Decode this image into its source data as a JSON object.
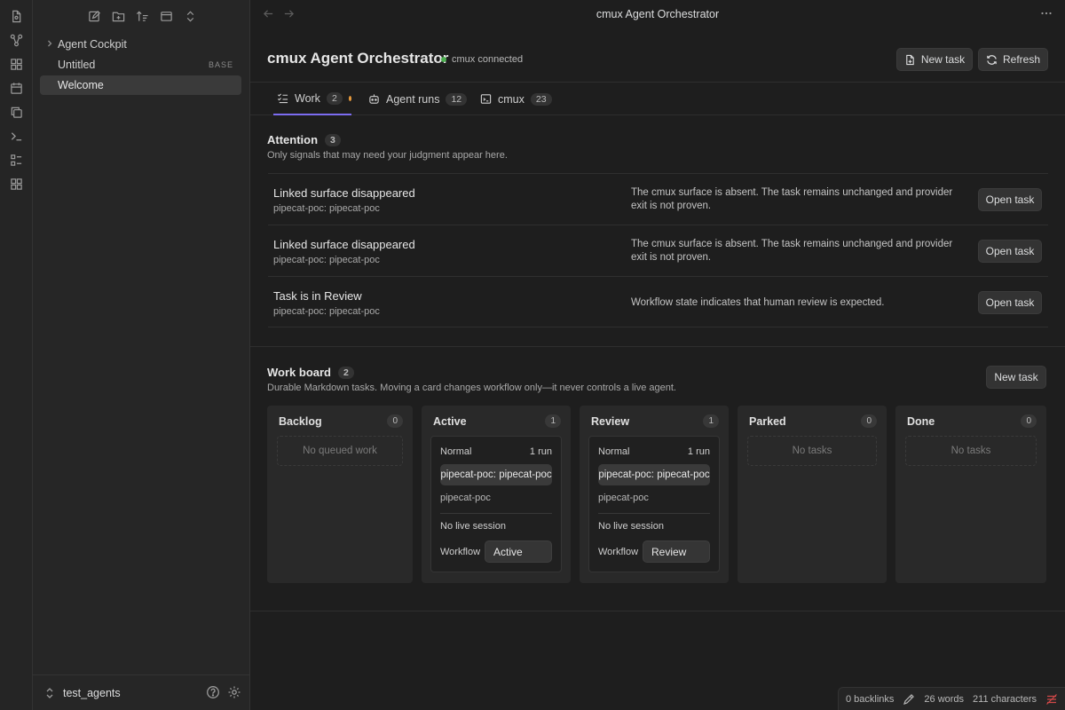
{
  "ribbon": {
    "icons": [
      "file-icon",
      "graph-icon",
      "grid-icon",
      "calendar-icon",
      "copy-icon",
      "terminal-icon",
      "list-icon",
      "blocks-icon"
    ]
  },
  "sidebar": {
    "toolbar_icons": [
      "new-note-icon",
      "new-folder-icon",
      "sort-icon",
      "collapse-icon",
      "expand-icon"
    ],
    "items": [
      {
        "label": "Agent Cockpit",
        "collapsed": true
      },
      {
        "label": "Untitled",
        "badge": "BASE"
      },
      {
        "label": "Welcome",
        "active": true
      }
    ],
    "vault": {
      "name": "test_agents"
    }
  },
  "titlebar": {
    "title": "cmux Agent Orchestrator"
  },
  "header": {
    "title": "cmux Agent Orchestrator",
    "connection": "cmux connected",
    "connection_color": "#4caf50",
    "new_task_label": "New task",
    "refresh_label": "Refresh"
  },
  "tabs": [
    {
      "label": "Work",
      "count": "2",
      "active": true,
      "dot_color": "#e89a3c"
    },
    {
      "label": "Agent runs",
      "count": "12"
    },
    {
      "label": "cmux",
      "count": "23"
    }
  ],
  "attention": {
    "title": "Attention",
    "count": "3",
    "subtitle": "Only signals that may need your judgment appear here.",
    "rows": [
      {
        "title": "Linked surface disappeared",
        "sub": "pipecat-poc: pipecat-poc",
        "desc": "The cmux surface is absent. The task remains unchanged and provider exit is not proven.",
        "action": "Open task"
      },
      {
        "title": "Linked surface disappeared",
        "sub": "pipecat-poc: pipecat-poc",
        "desc": "The cmux surface is absent. The task remains unchanged and provider exit is not proven.",
        "action": "Open task"
      },
      {
        "title": "Task is in Review",
        "sub": "pipecat-poc: pipecat-poc",
        "desc": "Workflow state indicates that human review is expected.",
        "action": "Open task"
      }
    ]
  },
  "board": {
    "title": "Work board",
    "count": "2",
    "subtitle": "Durable Markdown tasks. Moving a card changes workflow only—it never controls a live agent.",
    "new_task_label": "New task",
    "columns": [
      {
        "title": "Backlog",
        "count": "0",
        "empty": "No queued work"
      },
      {
        "title": "Active",
        "count": "1",
        "card": {
          "priority": "Normal",
          "runs": "1 run",
          "chip": "pipecat-poc: pipecat-poc",
          "project": "pipecat-poc",
          "session": "No live session",
          "workflow_label": "Workflow",
          "workflow_value": "Active"
        }
      },
      {
        "title": "Review",
        "count": "1",
        "card": {
          "priority": "Normal",
          "runs": "1 run",
          "chip": "pipecat-poc: pipecat-poc",
          "project": "pipecat-poc",
          "session": "No live session",
          "workflow_label": "Workflow",
          "workflow_value": "Review"
        }
      },
      {
        "title": "Parked",
        "count": "0",
        "empty": "No tasks"
      },
      {
        "title": "Done",
        "count": "0",
        "empty": "No tasks"
      }
    ]
  },
  "status_bar": {
    "backlinks": "0 backlinks",
    "words": "26 words",
    "characters": "211 characters"
  }
}
